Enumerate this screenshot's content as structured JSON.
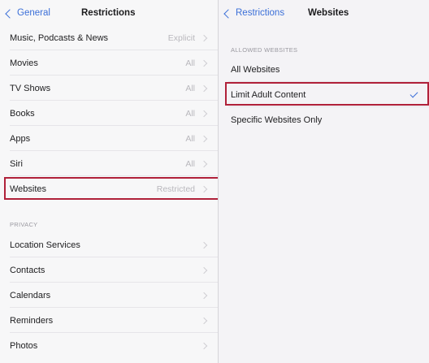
{
  "left": {
    "back_label": "General",
    "title": "Restrictions",
    "rows": [
      {
        "label": "Music, Podcasts & News",
        "value": "Explicit"
      },
      {
        "label": "Movies",
        "value": "All"
      },
      {
        "label": "TV Shows",
        "value": "All"
      },
      {
        "label": "Books",
        "value": "All"
      },
      {
        "label": "Apps",
        "value": "All"
      },
      {
        "label": "Siri",
        "value": "All"
      },
      {
        "label": "Websites",
        "value": "Restricted"
      }
    ],
    "privacy_header": "PRIVACY",
    "privacy_rows": [
      {
        "label": "Location Services"
      },
      {
        "label": "Contacts"
      },
      {
        "label": "Calendars"
      },
      {
        "label": "Reminders"
      },
      {
        "label": "Photos"
      }
    ]
  },
  "right": {
    "back_label": "Restrictions",
    "title": "Websites",
    "section_header": "ALLOWED WEBSITES",
    "options": [
      {
        "label": "All Websites",
        "selected": false
      },
      {
        "label": "Limit Adult Content",
        "selected": true
      },
      {
        "label": "Specific Websites Only",
        "selected": false
      }
    ]
  },
  "colors": {
    "accent": "#3b6fd8",
    "highlight_border": "#b0213a"
  }
}
